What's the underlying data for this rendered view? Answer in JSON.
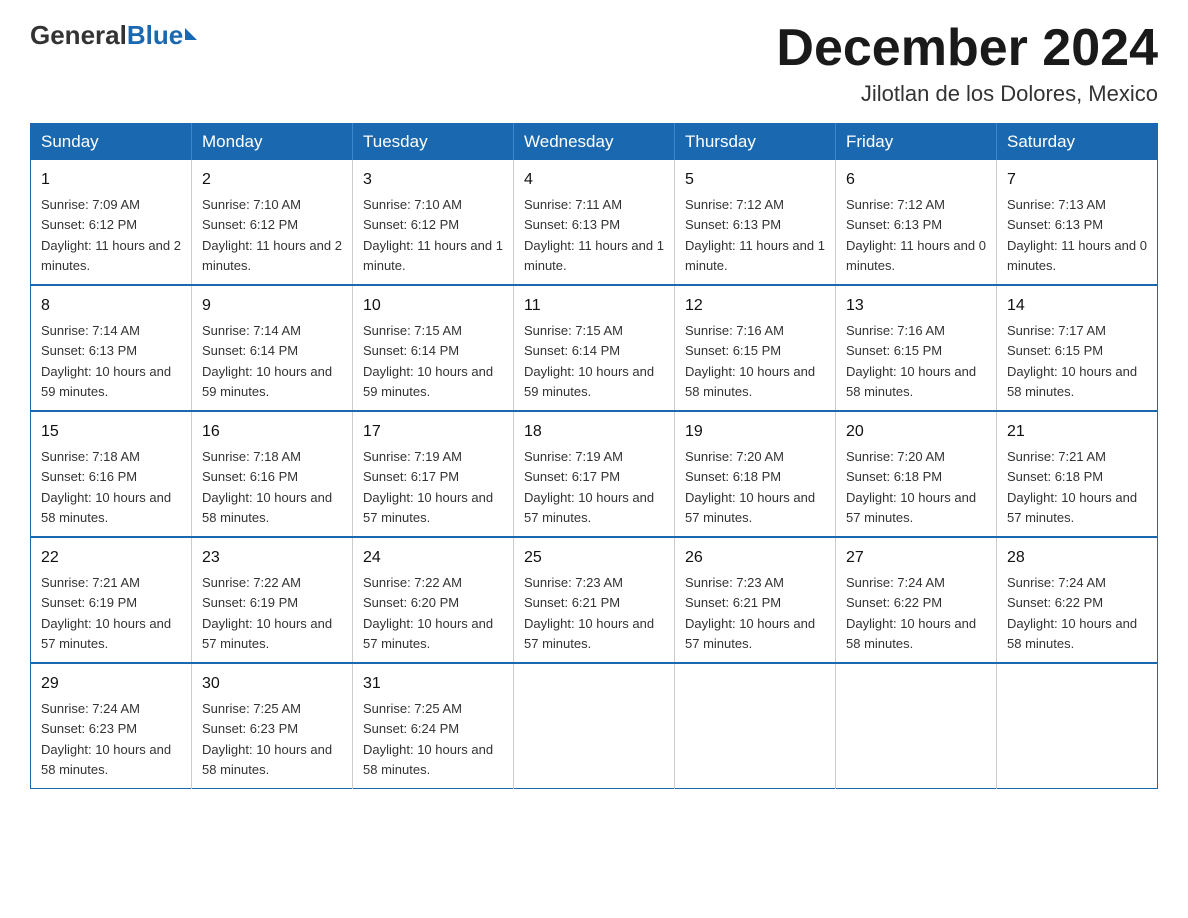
{
  "logo": {
    "general": "General",
    "blue": "Blue"
  },
  "header": {
    "month": "December 2024",
    "location": "Jilotlan de los Dolores, Mexico"
  },
  "days_of_week": [
    "Sunday",
    "Monday",
    "Tuesday",
    "Wednesday",
    "Thursday",
    "Friday",
    "Saturday"
  ],
  "weeks": [
    [
      {
        "day": "1",
        "sunrise": "7:09 AM",
        "sunset": "6:12 PM",
        "daylight": "11 hours and 2 minutes."
      },
      {
        "day": "2",
        "sunrise": "7:10 AM",
        "sunset": "6:12 PM",
        "daylight": "11 hours and 2 minutes."
      },
      {
        "day": "3",
        "sunrise": "7:10 AM",
        "sunset": "6:12 PM",
        "daylight": "11 hours and 1 minute."
      },
      {
        "day": "4",
        "sunrise": "7:11 AM",
        "sunset": "6:13 PM",
        "daylight": "11 hours and 1 minute."
      },
      {
        "day": "5",
        "sunrise": "7:12 AM",
        "sunset": "6:13 PM",
        "daylight": "11 hours and 1 minute."
      },
      {
        "day": "6",
        "sunrise": "7:12 AM",
        "sunset": "6:13 PM",
        "daylight": "11 hours and 0 minutes."
      },
      {
        "day": "7",
        "sunrise": "7:13 AM",
        "sunset": "6:13 PM",
        "daylight": "11 hours and 0 minutes."
      }
    ],
    [
      {
        "day": "8",
        "sunrise": "7:14 AM",
        "sunset": "6:13 PM",
        "daylight": "10 hours and 59 minutes."
      },
      {
        "day": "9",
        "sunrise": "7:14 AM",
        "sunset": "6:14 PM",
        "daylight": "10 hours and 59 minutes."
      },
      {
        "day": "10",
        "sunrise": "7:15 AM",
        "sunset": "6:14 PM",
        "daylight": "10 hours and 59 minutes."
      },
      {
        "day": "11",
        "sunrise": "7:15 AM",
        "sunset": "6:14 PM",
        "daylight": "10 hours and 59 minutes."
      },
      {
        "day": "12",
        "sunrise": "7:16 AM",
        "sunset": "6:15 PM",
        "daylight": "10 hours and 58 minutes."
      },
      {
        "day": "13",
        "sunrise": "7:16 AM",
        "sunset": "6:15 PM",
        "daylight": "10 hours and 58 minutes."
      },
      {
        "day": "14",
        "sunrise": "7:17 AM",
        "sunset": "6:15 PM",
        "daylight": "10 hours and 58 minutes."
      }
    ],
    [
      {
        "day": "15",
        "sunrise": "7:18 AM",
        "sunset": "6:16 PM",
        "daylight": "10 hours and 58 minutes."
      },
      {
        "day": "16",
        "sunrise": "7:18 AM",
        "sunset": "6:16 PM",
        "daylight": "10 hours and 58 minutes."
      },
      {
        "day": "17",
        "sunrise": "7:19 AM",
        "sunset": "6:17 PM",
        "daylight": "10 hours and 57 minutes."
      },
      {
        "day": "18",
        "sunrise": "7:19 AM",
        "sunset": "6:17 PM",
        "daylight": "10 hours and 57 minutes."
      },
      {
        "day": "19",
        "sunrise": "7:20 AM",
        "sunset": "6:18 PM",
        "daylight": "10 hours and 57 minutes."
      },
      {
        "day": "20",
        "sunrise": "7:20 AM",
        "sunset": "6:18 PM",
        "daylight": "10 hours and 57 minutes."
      },
      {
        "day": "21",
        "sunrise": "7:21 AM",
        "sunset": "6:18 PM",
        "daylight": "10 hours and 57 minutes."
      }
    ],
    [
      {
        "day": "22",
        "sunrise": "7:21 AM",
        "sunset": "6:19 PM",
        "daylight": "10 hours and 57 minutes."
      },
      {
        "day": "23",
        "sunrise": "7:22 AM",
        "sunset": "6:19 PM",
        "daylight": "10 hours and 57 minutes."
      },
      {
        "day": "24",
        "sunrise": "7:22 AM",
        "sunset": "6:20 PM",
        "daylight": "10 hours and 57 minutes."
      },
      {
        "day": "25",
        "sunrise": "7:23 AM",
        "sunset": "6:21 PM",
        "daylight": "10 hours and 57 minutes."
      },
      {
        "day": "26",
        "sunrise": "7:23 AM",
        "sunset": "6:21 PM",
        "daylight": "10 hours and 57 minutes."
      },
      {
        "day": "27",
        "sunrise": "7:24 AM",
        "sunset": "6:22 PM",
        "daylight": "10 hours and 58 minutes."
      },
      {
        "day": "28",
        "sunrise": "7:24 AM",
        "sunset": "6:22 PM",
        "daylight": "10 hours and 58 minutes."
      }
    ],
    [
      {
        "day": "29",
        "sunrise": "7:24 AM",
        "sunset": "6:23 PM",
        "daylight": "10 hours and 58 minutes."
      },
      {
        "day": "30",
        "sunrise": "7:25 AM",
        "sunset": "6:23 PM",
        "daylight": "10 hours and 58 minutes."
      },
      {
        "day": "31",
        "sunrise": "7:25 AM",
        "sunset": "6:24 PM",
        "daylight": "10 hours and 58 minutes."
      },
      null,
      null,
      null,
      null
    ]
  ],
  "labels": {
    "sunrise": "Sunrise:",
    "sunset": "Sunset:",
    "daylight": "Daylight:"
  }
}
